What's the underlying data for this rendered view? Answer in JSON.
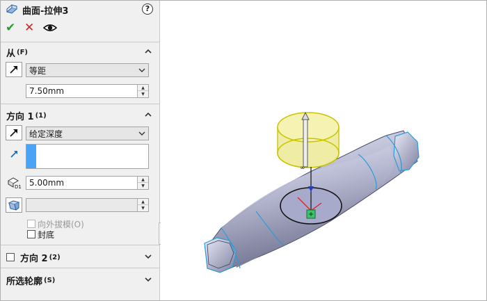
{
  "header": {
    "title": "曲面-拉伸3",
    "help": "?"
  },
  "actions": {
    "ok": "✔",
    "cancel": "✕"
  },
  "from_section": {
    "title": "从",
    "shortcut": "(F)",
    "condition": "等距",
    "offset_value": "7.50mm"
  },
  "direction1": {
    "title": "方向 1",
    "shortcut": "(1)",
    "end_condition": "给定深度",
    "depth_value": "5.00mm",
    "depth_icon_label": "D1",
    "draft_label": "向外拔模(O)",
    "cap_label": "封底"
  },
  "direction2": {
    "title": "方向 2",
    "shortcut": "(2)"
  },
  "selected_contours": {
    "title": "所选轮廓",
    "shortcut": "(S)"
  },
  "colors": {
    "selection_blue": "#4aa3f7",
    "ok_green": "#2a9d2a",
    "cancel_red": "#d62222",
    "preview_yellow": "#f2f08a",
    "tube_edge_blue": "#2d9bd8"
  },
  "icons": [
    "surface-extrude-icon",
    "help-icon",
    "ok-icon",
    "cancel-icon",
    "preview-eye-icon",
    "reverse-direction-icon",
    "direction-arrow-icon",
    "depth-dimension-icon",
    "draft-icon",
    "chevron-up-icon",
    "chevron-down-icon"
  ]
}
